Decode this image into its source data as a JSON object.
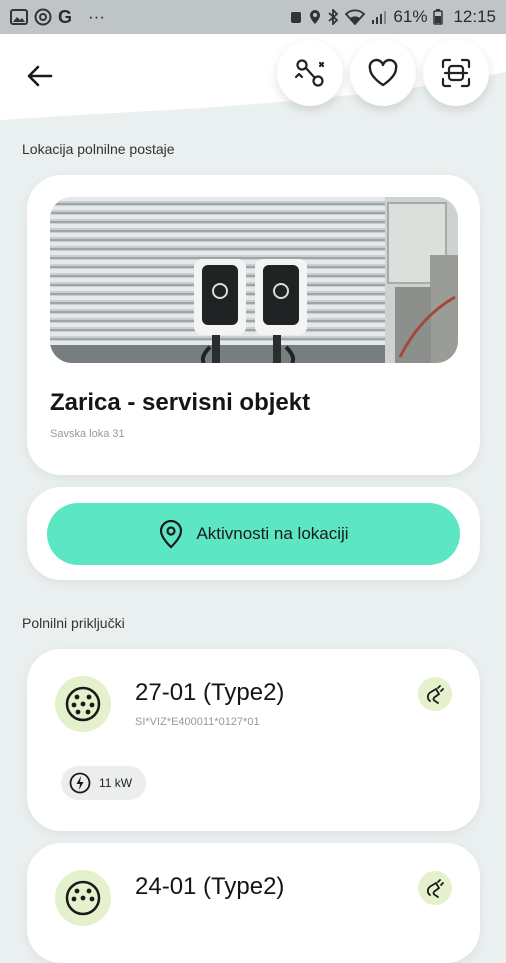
{
  "status_bar": {
    "battery": "61%",
    "time": "12:15",
    "overflow": "···"
  },
  "location_section": {
    "label": "Lokacija polnilne postaje"
  },
  "location": {
    "name": "Zarica - servisni objekt",
    "address": "Savska loka 31"
  },
  "actions": {
    "location_activity": "Aktivnosti na lokaciji"
  },
  "connectors_section": {
    "label": "Polnilni priključki"
  },
  "connectors": [
    {
      "title": "27-01 (Type2)",
      "id": "SI*VIZ*E400011*0127*01",
      "power": "11 kW"
    },
    {
      "title": "24-01 (Type2)"
    }
  ],
  "colors": {
    "accent": "#5ce6c3",
    "icon_bg": "#e5f0cc",
    "background": "#eaeff0"
  }
}
